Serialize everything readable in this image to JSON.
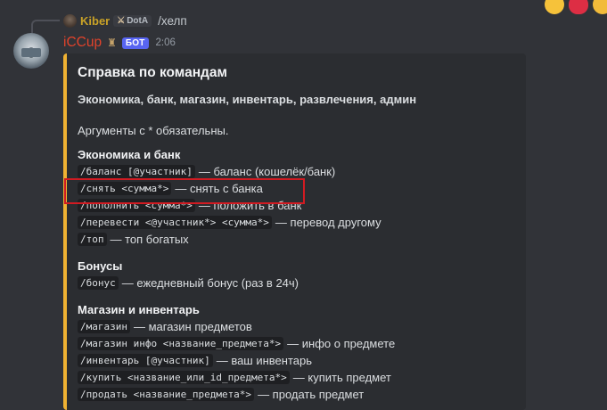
{
  "reply": {
    "username": "Kiber",
    "tag": "DotA",
    "text": "/хелп"
  },
  "reactions": [
    {
      "icon": "thumbs-up-icon"
    },
    {
      "icon": "heart-icon"
    },
    {
      "icon": "laughing-face-icon"
    }
  ],
  "message": {
    "author": "iCCup",
    "bot_badge": "БОТ",
    "timestamp": "2:06"
  },
  "embed": {
    "accent_color": "#f0b232",
    "title": "Справка по командам",
    "subtitle": "Экономика, банк, магазин, инвентарь, развлечения, админ",
    "note": "Аргументы с * обязательны.",
    "sections": [
      {
        "title": "Экономика и банк",
        "commands": [
          {
            "cmd": "/баланс [@участник]",
            "desc": "— баланс (кошелёк/банк)"
          },
          {
            "cmd": "/снять <сумма*>",
            "desc": "— снять с банка"
          },
          {
            "cmd": "/пополнить <сумма*>",
            "desc": "— положить в банк"
          },
          {
            "cmd": "/перевести <@участник*> <сумма*>",
            "desc": "— перевод другому"
          },
          {
            "cmd": "/топ",
            "desc": "— топ богатых"
          }
        ]
      },
      {
        "title": "Бонусы",
        "commands": [
          {
            "cmd": "/бонус",
            "desc": "— ежедневный бонус (раз в 24ч)"
          }
        ]
      },
      {
        "title": "Магазин и инвентарь",
        "commands": [
          {
            "cmd": "/магазин",
            "desc": "— магазин предметов"
          },
          {
            "cmd": "/магазин инфо <название_предмета*>",
            "desc": "— инфо о предмете"
          },
          {
            "cmd": "/инвентарь [@участник]",
            "desc": "— ваш инвентарь"
          },
          {
            "cmd": "/купить <название_или_id_предмета*>",
            "desc": "— купить предмет"
          },
          {
            "cmd": "/продать <название_предмета*>",
            "desc": "— продать предмет"
          }
        ]
      }
    ]
  }
}
